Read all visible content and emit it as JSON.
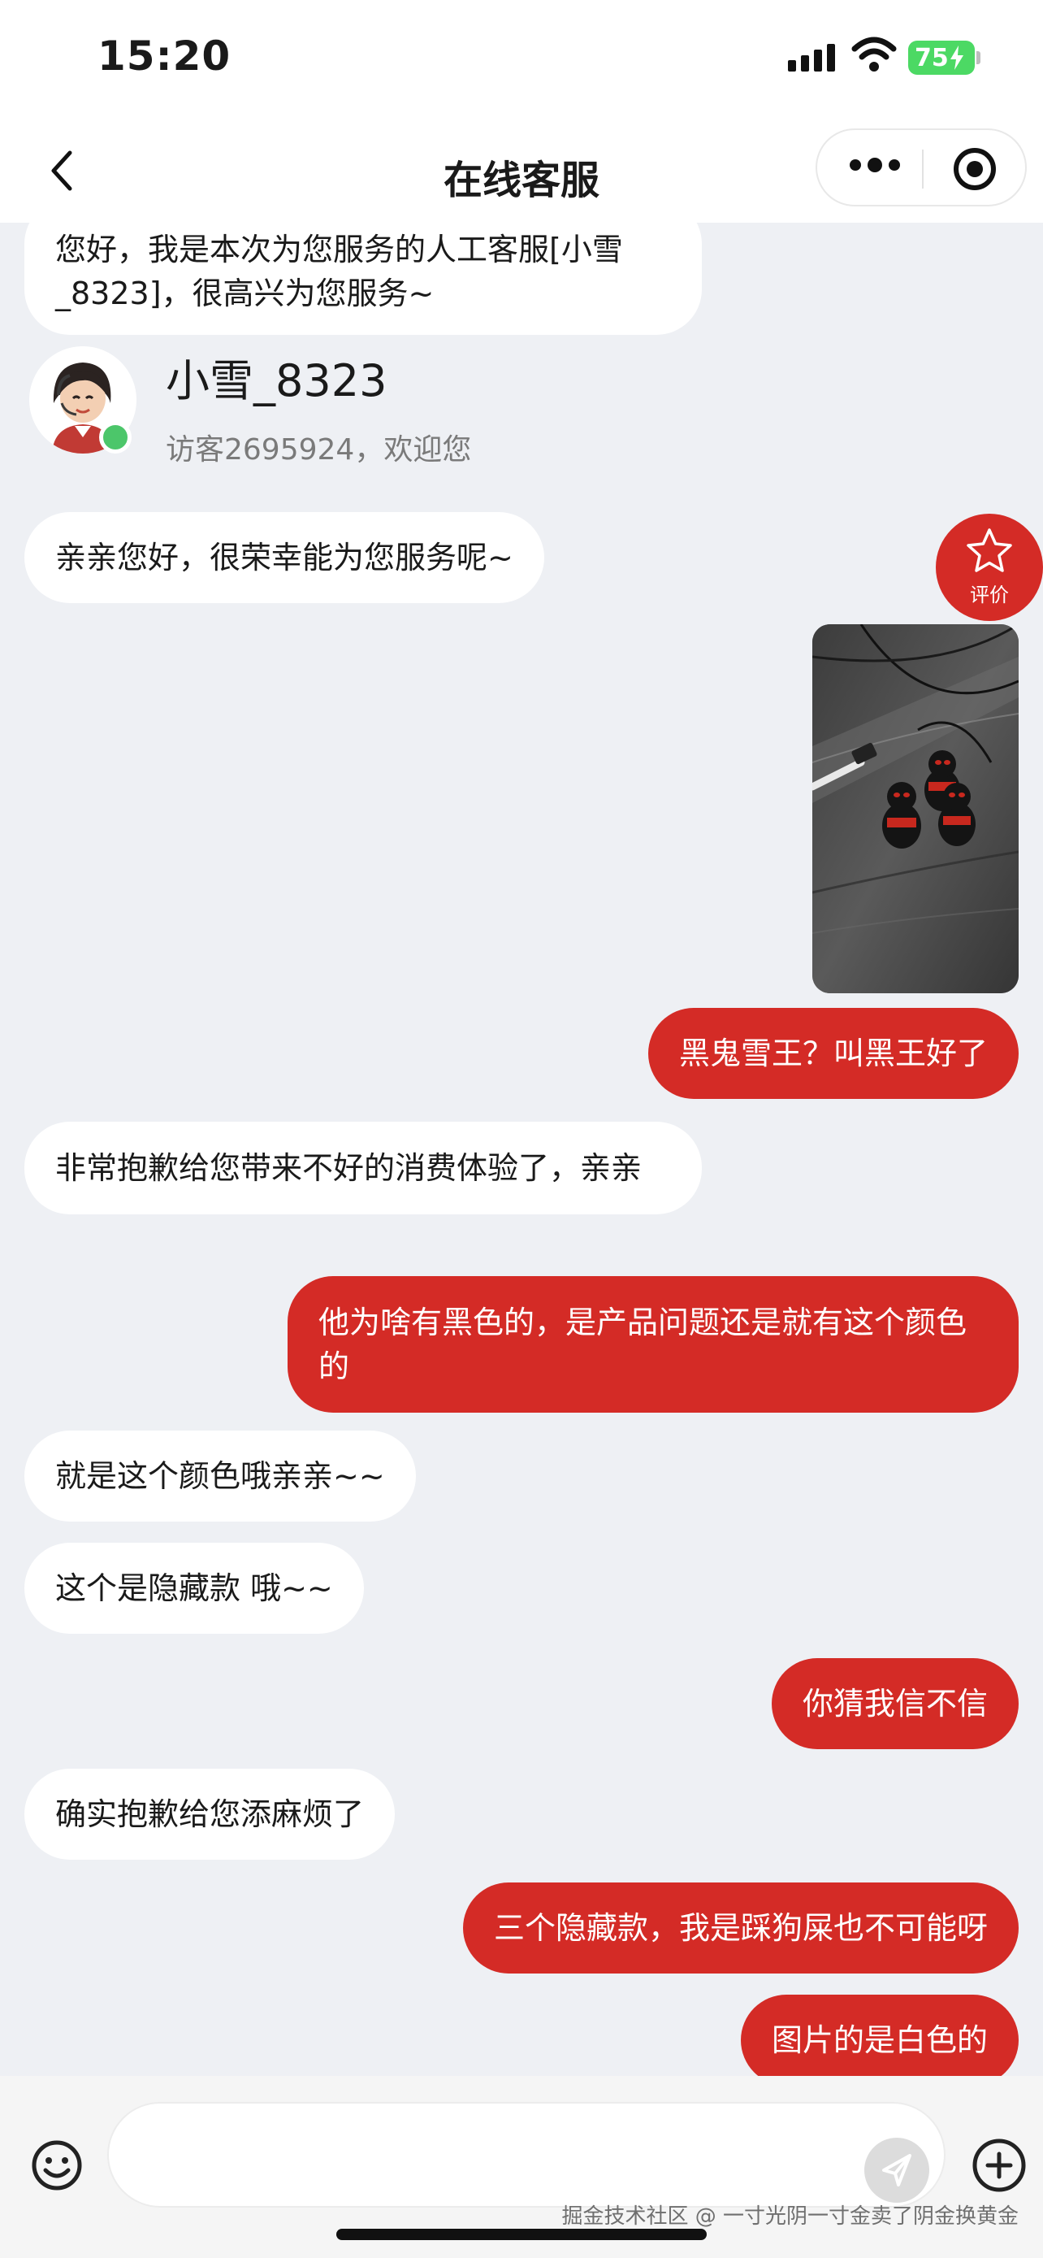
{
  "status_bar": {
    "time": "15:20",
    "battery": "75"
  },
  "nav": {
    "title": "在线客服"
  },
  "messages": {
    "m0": "您好，我是本次为您服务的人工客服[小雪_8323]，很高兴为您服务~",
    "m1": "亲亲您好，很荣幸能为您服务呢~",
    "m2": "黑鬼雪王？叫黑王好了",
    "m3": "非常抱歉给您带来不好的消费体验了，亲亲",
    "m4": "他为啥有黑色的，是产品问题还是就有这个颜色的",
    "m5": "就是这个颜色哦亲亲~~",
    "m6": "这个是隐藏款 哦~~",
    "m7": "你猜我信不信",
    "m8": "确实抱歉给您添麻烦了",
    "m9": "三个隐藏款，我是踩狗屎也不可能呀",
    "m10": "图片的是白色的"
  },
  "agent": {
    "name": "小雪_8323",
    "greeting": "访客2695924，欢迎您"
  },
  "rate": {
    "label": "评价"
  },
  "input": {
    "placeholder": ""
  },
  "watermark": "掘金技术社区 @ 一寸光阴一寸金卖了阴金换黄金",
  "colors": {
    "accent": "#d42b26",
    "online": "#4cc66a",
    "background": "#eef0f4"
  }
}
